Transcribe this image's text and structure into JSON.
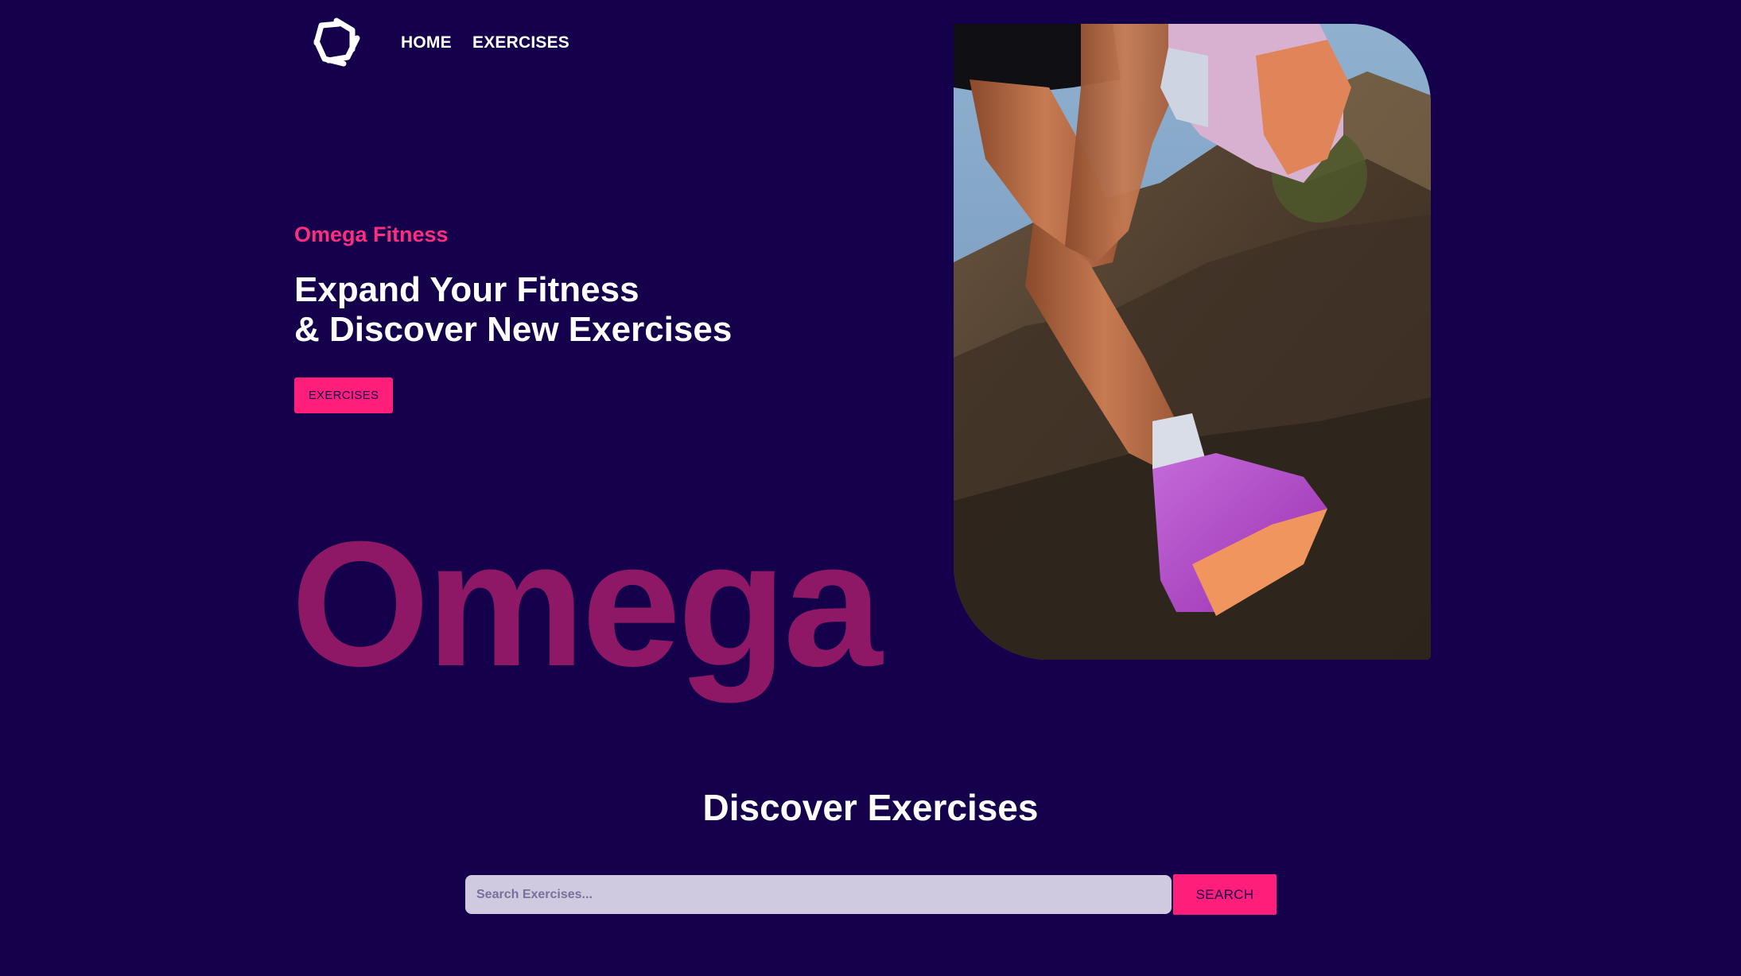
{
  "nav": {
    "logo_icon": "star-knot-logo-icon",
    "links": [
      {
        "label": "HOME"
      },
      {
        "label": "EXERCISES"
      }
    ]
  },
  "hero": {
    "kicker": "Omega Fitness",
    "title_line1": "Expand Your Fitness",
    "title_line2": "& Discover New Exercises",
    "button_label": "EXERCISES",
    "watermark": "Omega",
    "image_icon": "trail-runner-photo"
  },
  "discover": {
    "title": "Discover Exercises",
    "search_placeholder": "Search Exercises...",
    "search_value": "",
    "search_button_label": "SEARCH"
  },
  "colors": {
    "background": "#14004b",
    "accent": "#ff1f7a",
    "kicker": "#ff2d80",
    "watermark": "#8e1766",
    "input_bg": "#cfcae0"
  }
}
